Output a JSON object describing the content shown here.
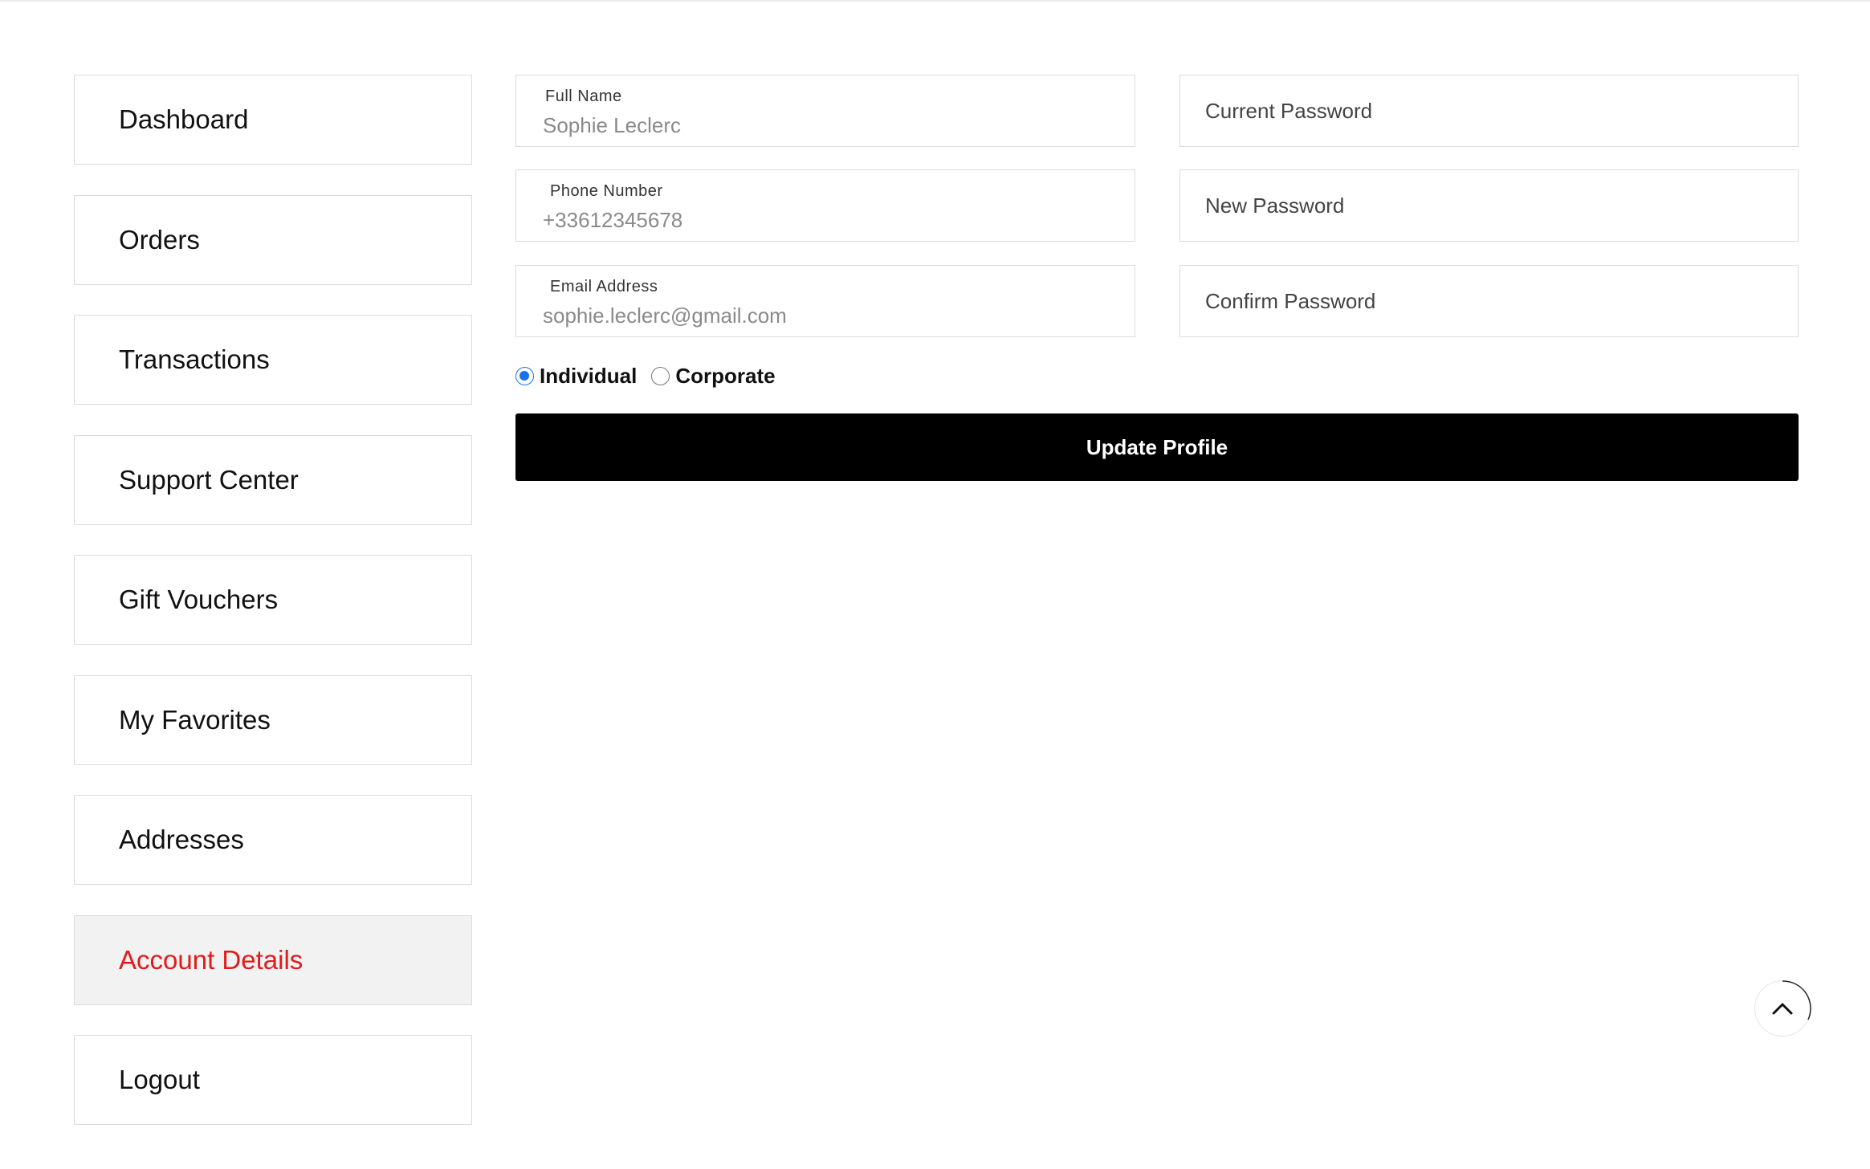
{
  "sidebar": {
    "items": [
      {
        "label": "Dashboard"
      },
      {
        "label": "Orders"
      },
      {
        "label": "Transactions"
      },
      {
        "label": "Support Center"
      },
      {
        "label": "Gift Vouchers"
      },
      {
        "label": "My Favorites"
      },
      {
        "label": "Addresses"
      },
      {
        "label": "Account Details",
        "active": true
      },
      {
        "label": "Logout"
      }
    ]
  },
  "profile": {
    "full_name": {
      "label": "Full Name",
      "value": "Sophie Leclerc"
    },
    "phone": {
      "label": "Phone Number",
      "value": "+33612345678"
    },
    "email": {
      "label": "Email Address",
      "value": "sophie.leclerc@gmail.com"
    }
  },
  "password": {
    "current_placeholder": "Current Password",
    "new_placeholder": "New Password",
    "confirm_placeholder": "Confirm Password"
  },
  "account_type": {
    "options": [
      "Individual",
      "Corporate"
    ],
    "selected": "Individual"
  },
  "actions": {
    "update_label": "Update Profile"
  },
  "colors": {
    "active_text": "#e01b1b",
    "active_bg": "#f2f2f2",
    "button_bg": "#000000",
    "radio_checked": "#1a73e8"
  },
  "icons": {
    "scroll_top": "chevron-up-icon"
  }
}
